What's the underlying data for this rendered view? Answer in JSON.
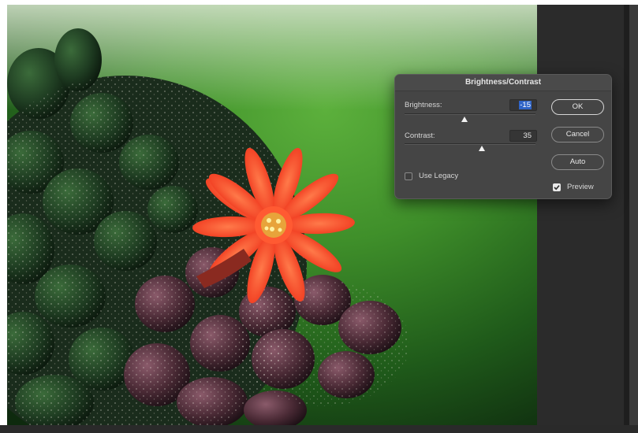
{
  "dialog": {
    "title": "Brightness/Contrast",
    "brightness": {
      "label": "Brightness:",
      "value": "-15",
      "slider_fraction": 0.46
    },
    "contrast": {
      "label": "Contrast:",
      "value": "35",
      "slider_fraction": 0.59
    },
    "buttons": {
      "ok": "OK",
      "cancel": "Cancel",
      "auto": "Auto"
    },
    "use_legacy": {
      "label": "Use Legacy",
      "checked": false
    },
    "preview": {
      "label": "Preview",
      "checked": true
    }
  },
  "canvas": {
    "subject": "red cactus flower on a spiny cactus cluster, blurred green background"
  },
  "colors": {
    "dialog_bg": "#454545",
    "selection_highlight": "#2f64c7",
    "flower": "#ff4a2a",
    "background_green": "#3c8a2a"
  },
  "icons": {
    "preview_check": "checkmark-icon"
  }
}
